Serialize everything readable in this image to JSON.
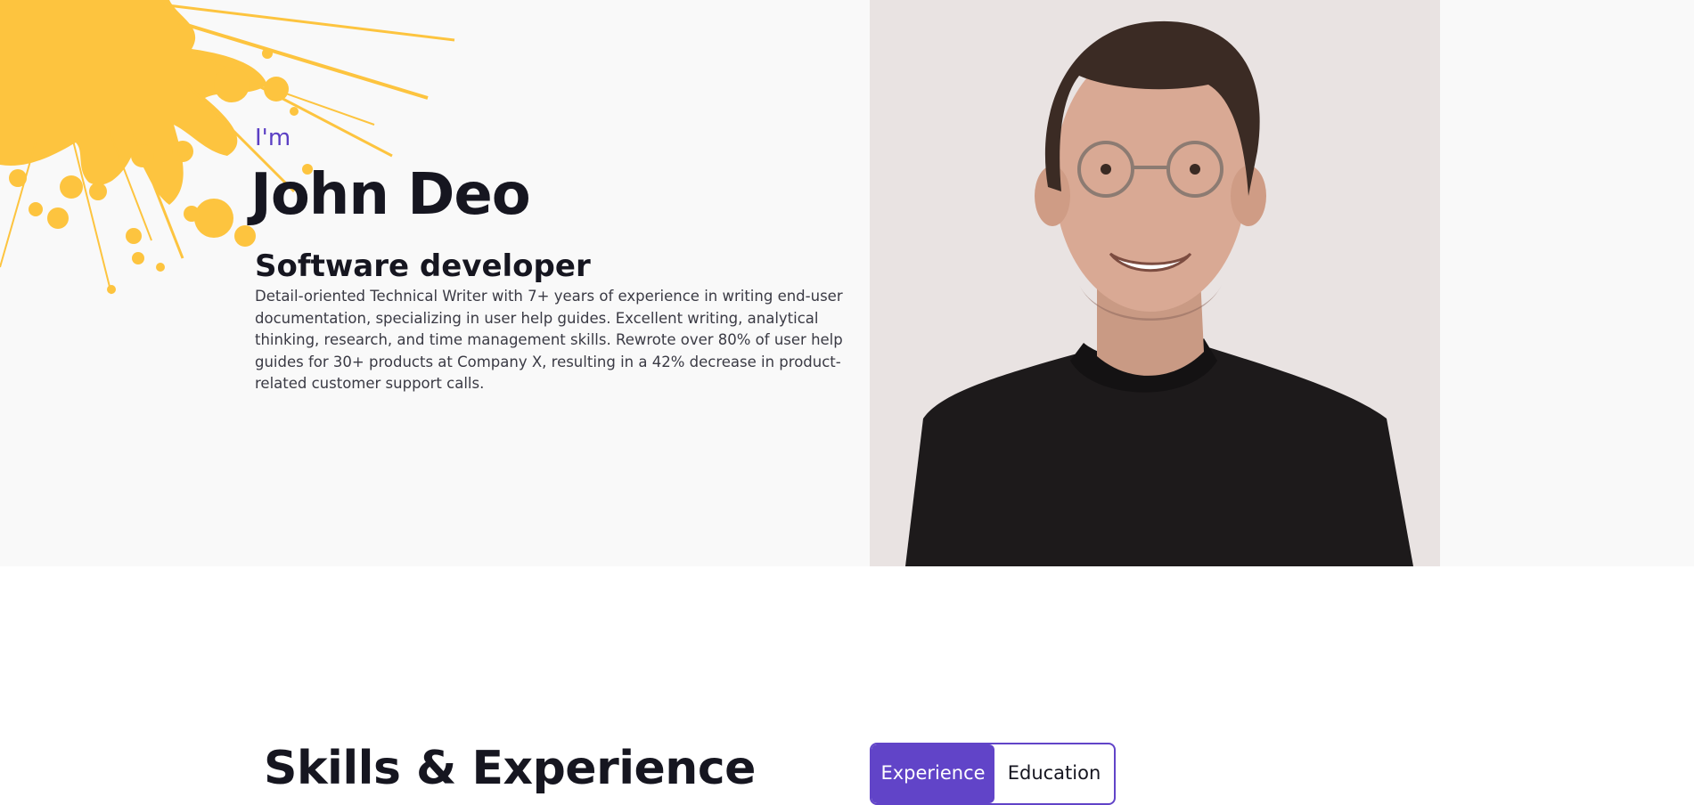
{
  "hero": {
    "greeting": "I'm",
    "name": "John Deo",
    "role": "Software developer",
    "bio": "Detail-oriented Technical Writer with 7+ years of experience in writing end-user documentation, specializing in user help guides. Excellent writing, analytical thinking, research, and time management skills. Rewrote over 80% of user help guides for 30+ products at Company X, resulting in a 42% decrease in product-related customer support calls."
  },
  "skills": {
    "title": "Skills & Experience",
    "tabs": [
      {
        "label": "Experience",
        "active": true
      },
      {
        "label": "Education",
        "active": false
      }
    ]
  },
  "colors": {
    "accent": "#6144c8",
    "splash": "#fdc43f",
    "hero_bg": "#f9f9f9"
  }
}
